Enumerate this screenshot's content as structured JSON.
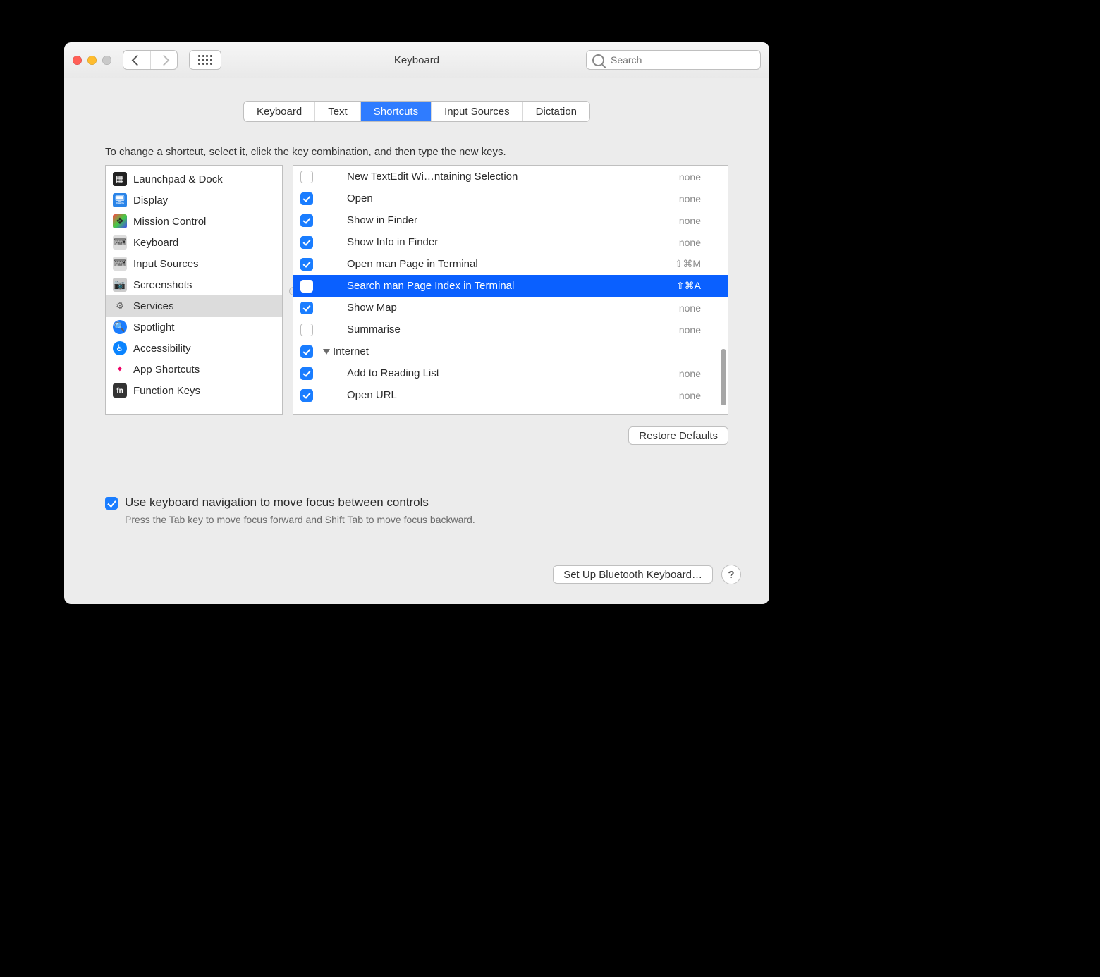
{
  "window": {
    "title": "Keyboard"
  },
  "search": {
    "placeholder": "Search"
  },
  "tabs": [
    {
      "label": "Keyboard",
      "active": false
    },
    {
      "label": "Text",
      "active": false
    },
    {
      "label": "Shortcuts",
      "active": true
    },
    {
      "label": "Input Sources",
      "active": false
    },
    {
      "label": "Dictation",
      "active": false
    }
  ],
  "instruction": "To change a shortcut, select it, click the key combination, and then type the new keys.",
  "categories": [
    {
      "label": "Launchpad & Dock",
      "icon": "launchpad",
      "selected": false
    },
    {
      "label": "Display",
      "icon": "display",
      "selected": false
    },
    {
      "label": "Mission Control",
      "icon": "mission",
      "selected": false
    },
    {
      "label": "Keyboard",
      "icon": "keyboard",
      "selected": false
    },
    {
      "label": "Input Sources",
      "icon": "input",
      "selected": false
    },
    {
      "label": "Screenshots",
      "icon": "screenshot",
      "selected": false
    },
    {
      "label": "Services",
      "icon": "services",
      "selected": true
    },
    {
      "label": "Spotlight",
      "icon": "spotlight",
      "selected": false
    },
    {
      "label": "Accessibility",
      "icon": "accessibility",
      "selected": false
    },
    {
      "label": "App Shortcuts",
      "icon": "apps",
      "selected": false
    },
    {
      "label": "Function Keys",
      "icon": "fn",
      "selected": false
    }
  ],
  "services": [
    {
      "type": "item",
      "checked": false,
      "label": "New TextEdit Wi…ntaining Selection",
      "value": "none",
      "selected": false
    },
    {
      "type": "item",
      "checked": true,
      "label": "Open",
      "value": "none",
      "selected": false
    },
    {
      "type": "item",
      "checked": true,
      "label": "Show in Finder",
      "value": "none",
      "selected": false
    },
    {
      "type": "item",
      "checked": true,
      "label": "Show Info in Finder",
      "value": "none",
      "selected": false
    },
    {
      "type": "item",
      "checked": true,
      "label": "Open man Page in Terminal",
      "value": "⇧⌘M",
      "selected": false
    },
    {
      "type": "item",
      "checked": false,
      "label": "Search man Page Index in Terminal",
      "value": "⇧⌘A",
      "selected": true
    },
    {
      "type": "item",
      "checked": true,
      "label": "Show Map",
      "value": "none",
      "selected": false
    },
    {
      "type": "item",
      "checked": false,
      "label": "Summarise",
      "value": "none",
      "selected": false
    },
    {
      "type": "group",
      "checked": true,
      "label": "Internet"
    },
    {
      "type": "item",
      "checked": true,
      "label": "Add to Reading List",
      "value": "none",
      "selected": false
    },
    {
      "type": "item",
      "checked": true,
      "label": "Open URL",
      "value": "none",
      "selected": false
    }
  ],
  "restore_label": "Restore Defaults",
  "kbnav": {
    "label": "Use keyboard navigation to move focus between controls",
    "hint": "Press the Tab key to move focus forward and Shift Tab to move focus backward."
  },
  "bluetooth_label": "Set Up Bluetooth Keyboard…"
}
